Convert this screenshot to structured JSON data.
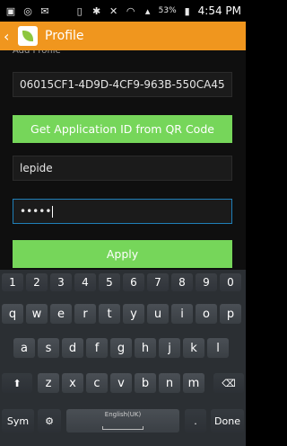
{
  "status_bar": {
    "icons_left": [
      "image-icon",
      "whatsapp-icon",
      "envelope-icon"
    ],
    "icons_right": [
      "vibrate-icon",
      "bluetooth-icon",
      "mute-icon",
      "wifi-icon",
      "signal-icon",
      "battery-icon"
    ],
    "battery_text": "53%",
    "time": "4:54 PM"
  },
  "action_bar": {
    "title": "Profile"
  },
  "form": {
    "partial_label": "Add Profile",
    "app_id_value": "06015CF1-4D9D-4CF9-963B-550CA45",
    "qr_button_label": "Get Application ID from QR Code",
    "username_value": "lepide",
    "password_value": "•••••",
    "apply_button_label": "Apply"
  },
  "keyboard": {
    "numbers": [
      "1",
      "2",
      "3",
      "4",
      "5",
      "6",
      "7",
      "8",
      "9",
      "0"
    ],
    "row1": [
      "q",
      "w",
      "e",
      "r",
      "t",
      "y",
      "u",
      "i",
      "o",
      "p"
    ],
    "row2": [
      "a",
      "s",
      "d",
      "f",
      "g",
      "h",
      "j",
      "k",
      "l"
    ],
    "row3": [
      "z",
      "x",
      "c",
      "v",
      "b",
      "n",
      "m"
    ],
    "sym_label": "Sym",
    "space_label": "English(UK)",
    "period_label": ".",
    "done_label": "Done",
    "shift_symbol": "⬆",
    "delete_symbol": "⌫",
    "settings_symbol": "⚙"
  }
}
